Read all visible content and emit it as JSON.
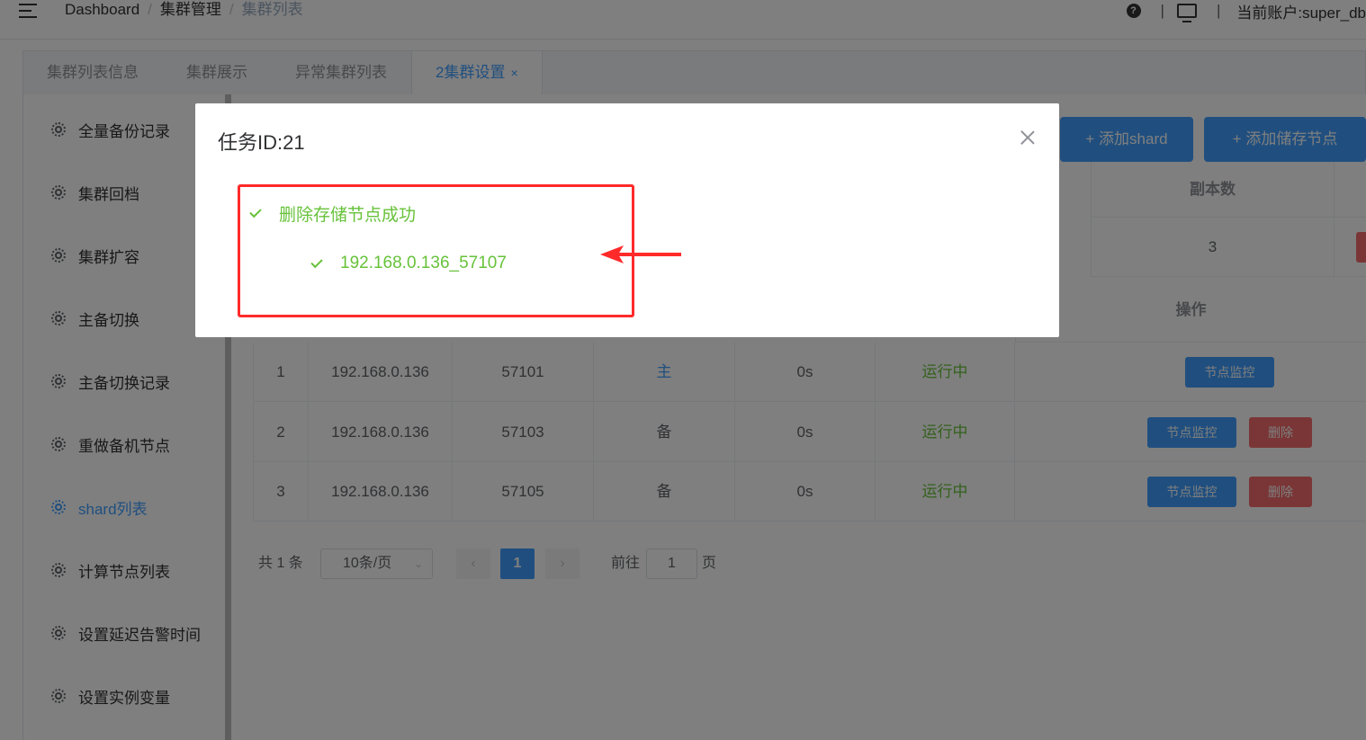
{
  "header": {
    "breadcrumb": [
      "Dashboard",
      "集群管理",
      "集群列表"
    ],
    "separator": "/",
    "divider": "|",
    "account_label": "当前账户:super_db"
  },
  "tabs": [
    {
      "label": "集群列表信息"
    },
    {
      "label": "集群展示"
    },
    {
      "label": "异常集群列表"
    },
    {
      "label": "2集群设置",
      "closable": true,
      "close_glyph": "×"
    }
  ],
  "sidebar": {
    "items": [
      {
        "label": "全量备份记录"
      },
      {
        "label": "集群回档"
      },
      {
        "label": "集群扩容"
      },
      {
        "label": "主备切换"
      },
      {
        "label": "主备切换记录"
      },
      {
        "label": "重做备机节点"
      },
      {
        "label": "shard列表",
        "active": true
      },
      {
        "label": "计算节点列表"
      },
      {
        "label": "设置延迟告警时间"
      },
      {
        "label": "设置实例变量"
      }
    ]
  },
  "toolbar": {
    "add_shard": "+ 添加shard",
    "add_storage_node": "+ 添加储存节点"
  },
  "shard_table": {
    "replica_header": "副本数",
    "replica_value": "3"
  },
  "node_table": {
    "operation_header": "操作",
    "rows": [
      {
        "no": "1",
        "ip": "192.168.0.136",
        "port": "57101",
        "role": "主",
        "delay": "0s",
        "status": "运行中"
      },
      {
        "no": "2",
        "ip": "192.168.0.136",
        "port": "57103",
        "role": "备",
        "delay": "0s",
        "status": "运行中"
      },
      {
        "no": "3",
        "ip": "192.168.0.136",
        "port": "57105",
        "role": "备",
        "delay": "0s",
        "status": "运行中"
      }
    ],
    "monitor_label": "节点监控",
    "delete_label": "删除"
  },
  "pagination": {
    "total": "共 1 条",
    "page_size": "10条/页",
    "current_page": "1",
    "goto_label": "前往",
    "goto_value": "1",
    "page_unit": "页",
    "prev_glyph": "‹",
    "next_glyph": "›",
    "size_chevron": "⌄"
  },
  "dialog": {
    "title": "任务ID:21",
    "result_title": "删除存储节点成功",
    "result_item": "192.168.0.136_57107"
  },
  "colors": {
    "primary": "#409eff",
    "success": "#67c23a",
    "danger": "#f56c6c",
    "annotation_red": "#ff2a2a"
  },
  "icons": {
    "menu": "hamburger-icon",
    "help": "question-circle-icon",
    "screen": "monitor-icon",
    "menu_item": "gear-icon",
    "success": "check-icon",
    "close": "close-icon"
  }
}
